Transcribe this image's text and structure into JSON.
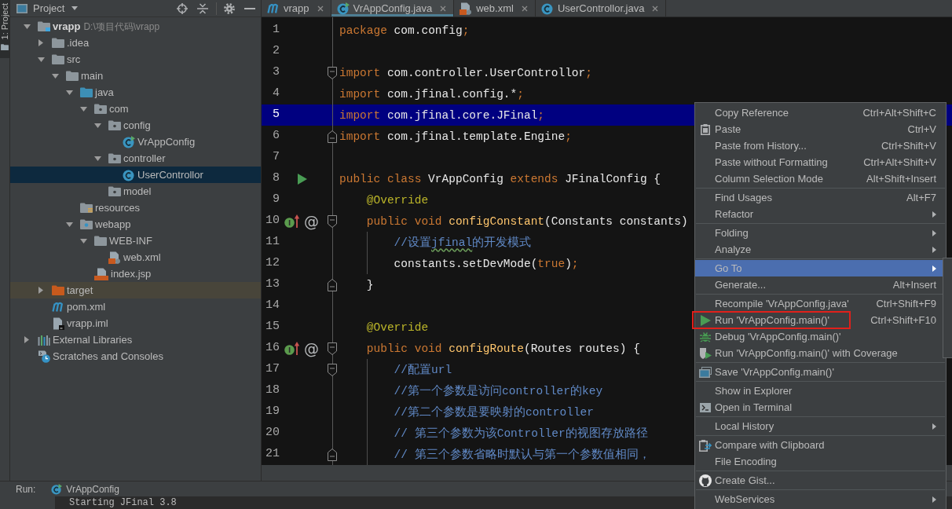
{
  "tool_strip": {
    "tabs": [
      {
        "label": "1: Project",
        "selected": true
      }
    ]
  },
  "project_panel": {
    "title": "Project",
    "tree": [
      {
        "label": "vrapp",
        "path": "D:\\项目代码\\vrapp",
        "kind": "module",
        "expanded": true,
        "selected": false,
        "children": [
          {
            "label": ".idea",
            "kind": "folder",
            "expanded": false,
            "selected": false
          },
          {
            "label": "src",
            "kind": "folder",
            "expanded": true,
            "selected": false,
            "children": [
              {
                "label": "main",
                "kind": "folder",
                "expanded": true,
                "selected": false,
                "children": [
                  {
                    "label": "java",
                    "kind": "source-folder",
                    "expanded": true,
                    "selected": false,
                    "children": [
                      {
                        "label": "com",
                        "kind": "package",
                        "expanded": true,
                        "selected": false,
                        "children": [
                          {
                            "label": "config",
                            "kind": "package",
                            "expanded": true,
                            "selected": false,
                            "children": [
                              {
                                "label": "VrAppConfig",
                                "kind": "runnable-class",
                                "selected": false
                              }
                            ]
                          },
                          {
                            "label": "controller",
                            "kind": "package",
                            "expanded": true,
                            "selected": false,
                            "children": [
                              {
                                "label": "UserControllor",
                                "kind": "class",
                                "selected": true
                              }
                            ]
                          },
                          {
                            "label": "model",
                            "kind": "package",
                            "selected": false
                          }
                        ]
                      }
                    ]
                  },
                  {
                    "label": "resources",
                    "kind": "resources-folder",
                    "selected": false
                  },
                  {
                    "label": "webapp",
                    "kind": "web-folder",
                    "expanded": true,
                    "selected": false,
                    "children": [
                      {
                        "label": "WEB-INF",
                        "kind": "folder",
                        "expanded": true,
                        "selected": false,
                        "children": [
                          {
                            "label": "web.xml",
                            "kind": "xml",
                            "selected": false
                          }
                        ]
                      },
                      {
                        "label": "index.jsp",
                        "kind": "jsp",
                        "selected": false
                      }
                    ]
                  }
                ]
              }
            ]
          },
          {
            "label": "target",
            "kind": "excluded-folder",
            "expanded": false,
            "selected": false
          },
          {
            "label": "pom.xml",
            "kind": "maven",
            "selected": false
          },
          {
            "label": "vrapp.iml",
            "kind": "iml",
            "selected": false
          }
        ]
      },
      {
        "label": "External Libraries",
        "kind": "libraries",
        "expanded": false,
        "selected": false
      },
      {
        "label": "Scratches and Consoles",
        "kind": "scratches",
        "selected": false
      }
    ]
  },
  "editor": {
    "tabs": [
      {
        "label": "vrapp",
        "kind": "maven",
        "selected": false
      },
      {
        "label": "VrAppConfig.java",
        "kind": "runnable-class",
        "selected": true
      },
      {
        "label": "web.xml",
        "kind": "xml",
        "selected": false
      },
      {
        "label": "UserControllor.java",
        "kind": "class",
        "selected": false
      }
    ],
    "lines": [
      {
        "number": "1",
        "selected": false,
        "tokens": [
          {
            "kind": "keyword",
            "text": "package"
          },
          {
            "kind": "text",
            "text": " com.config"
          },
          {
            "kind": "punctuation",
            "text": ";"
          }
        ]
      },
      {
        "number": "2",
        "selected": false
      },
      {
        "number": "3",
        "selected": false,
        "fold": {
          "kind": "start"
        },
        "tokens": [
          {
            "kind": "keyword",
            "text": "import"
          },
          {
            "kind": "text",
            "text": " com.controller.UserControllor"
          },
          {
            "kind": "punctuation",
            "text": ";"
          }
        ]
      },
      {
        "number": "4",
        "selected": false,
        "tokens": [
          {
            "kind": "keyword",
            "text": "import"
          },
          {
            "kind": "text",
            "text": " com.jfinal.config.*"
          },
          {
            "kind": "punctuation",
            "text": ";"
          }
        ]
      },
      {
        "number": "5",
        "selected": true,
        "tokens": [
          {
            "kind": "keyword",
            "text": "import"
          },
          {
            "kind": "text",
            "text": " com.jfinal.core.JFinal"
          },
          {
            "kind": "punctuation",
            "text": ";"
          }
        ]
      },
      {
        "number": "6",
        "selected": false,
        "fold": {
          "kind": "end"
        },
        "tokens": [
          {
            "kind": "keyword",
            "text": "import"
          },
          {
            "kind": "text",
            "text": " com.jfinal.template.Engine"
          },
          {
            "kind": "punctuation",
            "text": ";"
          }
        ]
      },
      {
        "number": "7",
        "selected": false
      },
      {
        "number": "8",
        "selected": false,
        "marker": {
          "kind": "run"
        },
        "tokens": [
          {
            "kind": "keyword",
            "text": "public class"
          },
          {
            "kind": "text",
            "text": " VrAppConfig "
          },
          {
            "kind": "keyword",
            "text": "extends"
          },
          {
            "kind": "text",
            "text": " JFinalConfig {"
          }
        ]
      },
      {
        "number": "9",
        "selected": false,
        "tokens": [
          {
            "kind": "annotation",
            "text": "    @Override"
          }
        ]
      },
      {
        "number": "10",
        "selected": false,
        "marker": {
          "kind": "override",
          "mark": "@"
        },
        "fold": {
          "kind": "start"
        },
        "tokens": [
          {
            "kind": "keyword",
            "text": "    public void "
          },
          {
            "kind": "method",
            "text": "configConstant"
          },
          {
            "kind": "text",
            "text": "(Constants constants)"
          }
        ]
      },
      {
        "number": "11",
        "selected": false,
        "tokens": [
          {
            "kind": "comment",
            "text": "        //设置"
          },
          {
            "kind": "comment",
            "text": "jfinal",
            "typo": true
          },
          {
            "kind": "comment",
            "text": "的开发模式"
          }
        ]
      },
      {
        "number": "12",
        "selected": false,
        "tokens": [
          {
            "kind": "text",
            "text": "        constants.setDevMode("
          },
          {
            "kind": "keyword",
            "text": "true"
          },
          {
            "kind": "text",
            "text": ")"
          },
          {
            "kind": "punctuation",
            "text": ";"
          }
        ]
      },
      {
        "number": "13",
        "selected": false,
        "fold": {
          "kind": "end"
        },
        "tokens": [
          {
            "kind": "text",
            "text": "    }"
          }
        ]
      },
      {
        "number": "14",
        "selected": false
      },
      {
        "number": "15",
        "selected": false,
        "tokens": [
          {
            "kind": "annotation",
            "text": "    @Override"
          }
        ]
      },
      {
        "number": "16",
        "selected": false,
        "marker": {
          "kind": "override",
          "mark": "@"
        },
        "fold": {
          "kind": "start"
        },
        "tokens": [
          {
            "kind": "keyword",
            "text": "    public void "
          },
          {
            "kind": "method",
            "text": "configRoute"
          },
          {
            "kind": "text",
            "text": "(Routes routes) {"
          }
        ]
      },
      {
        "number": "17",
        "selected": false,
        "fold": {
          "kind": "start"
        },
        "tokens": [
          {
            "kind": "comment",
            "text": "        //配置url"
          }
        ]
      },
      {
        "number": "18",
        "selected": false,
        "tokens": [
          {
            "kind": "comment",
            "text": "        //第一个参数是访问controller的key"
          }
        ]
      },
      {
        "number": "19",
        "selected": false,
        "tokens": [
          {
            "kind": "comment",
            "text": "        //第二个参数是要映射的controller"
          }
        ]
      },
      {
        "number": "20",
        "selected": false,
        "tokens": [
          {
            "kind": "comment",
            "text": "        // 第三个参数为该Controller的视图存放路径"
          }
        ]
      },
      {
        "number": "21",
        "selected": false,
        "fold": {
          "kind": "end"
        },
        "tokens": [
          {
            "kind": "comment",
            "text": "        // 第三个参数省略时默认与第一个参数值相同，"
          }
        ]
      }
    ]
  },
  "context_menu": {
    "groups": [
      {
        "items": [
          {
            "label": "Copy Reference",
            "shortcut": "Ctrl+Alt+Shift+C",
            "kind": "plain",
            "submenu": false,
            "selected": false,
            "outlined": false
          },
          {
            "label": "Paste",
            "shortcut": "Ctrl+V",
            "kind": "paste",
            "submenu": false,
            "selected": false,
            "outlined": false
          },
          {
            "label": "Paste from History...",
            "shortcut": "Ctrl+Shift+V",
            "kind": "plain",
            "submenu": false,
            "selected": false,
            "outlined": false
          },
          {
            "label": "Paste without Formatting",
            "shortcut": "Ctrl+Alt+Shift+V",
            "kind": "plain",
            "submenu": false,
            "selected": false,
            "outlined": false
          },
          {
            "label": "Column Selection Mode",
            "shortcut": "Alt+Shift+Insert",
            "kind": "plain",
            "submenu": false,
            "selected": false,
            "outlined": false
          }
        ]
      },
      {
        "items": [
          {
            "label": "Find Usages",
            "shortcut": "Alt+F7",
            "kind": "plain",
            "submenu": false,
            "selected": false,
            "outlined": false
          },
          {
            "label": "Refactor",
            "kind": "plain",
            "submenu": true,
            "selected": false,
            "outlined": false
          }
        ]
      },
      {
        "items": [
          {
            "label": "Folding",
            "kind": "plain",
            "submenu": true,
            "selected": false,
            "outlined": false
          },
          {
            "label": "Analyze",
            "kind": "plain",
            "submenu": true,
            "selected": false,
            "outlined": false
          }
        ]
      },
      {
        "items": [
          {
            "label": "Go To",
            "kind": "plain",
            "submenu": true,
            "selected": true,
            "outlined": false
          },
          {
            "label": "Generate...",
            "shortcut": "Alt+Insert",
            "kind": "plain",
            "submenu": false,
            "selected": false,
            "outlined": false
          }
        ]
      },
      {
        "items": [
          {
            "label": "Recompile 'VrAppConfig.java'",
            "shortcut": "Ctrl+Shift+F9",
            "kind": "plain",
            "submenu": false,
            "selected": false,
            "outlined": false
          },
          {
            "label": "Run 'VrAppConfig.main()'",
            "shortcut": "Ctrl+Shift+F10",
            "kind": "run",
            "submenu": false,
            "selected": false,
            "outlined": true
          },
          {
            "label": "Debug 'VrAppConfig.main()'",
            "kind": "debug",
            "submenu": false,
            "selected": false,
            "outlined": false
          },
          {
            "label": "Run 'VrAppConfig.main()' with Coverage",
            "kind": "coverage",
            "submenu": false,
            "selected": false,
            "outlined": false
          }
        ]
      },
      {
        "items": [
          {
            "label": "Save 'VrAppConfig.main()'",
            "kind": "save",
            "submenu": false,
            "selected": false,
            "outlined": false
          }
        ]
      },
      {
        "items": [
          {
            "label": "Show in Explorer",
            "kind": "plain",
            "submenu": false,
            "selected": false,
            "outlined": false
          },
          {
            "label": "Open in Terminal",
            "kind": "terminal",
            "submenu": false,
            "selected": false,
            "outlined": false
          }
        ]
      },
      {
        "items": [
          {
            "label": "Local History",
            "kind": "plain",
            "submenu": true,
            "selected": false,
            "outlined": false
          }
        ]
      },
      {
        "items": [
          {
            "label": "Compare with Clipboard",
            "kind": "compare",
            "submenu": false,
            "selected": false,
            "outlined": false
          },
          {
            "label": "File Encoding",
            "kind": "plain",
            "submenu": false,
            "selected": false,
            "outlined": false
          }
        ]
      },
      {
        "items": [
          {
            "label": "Create Gist...",
            "kind": "github",
            "submenu": false,
            "selected": false,
            "outlined": false
          }
        ]
      },
      {
        "items": [
          {
            "label": "WebServices",
            "kind": "plain",
            "submenu": true,
            "selected": false,
            "outlined": false
          }
        ]
      }
    ]
  },
  "run_panel": {
    "title": "Run:",
    "tab": "VrAppConfig",
    "console": "Starting JFinal 3.8"
  }
}
